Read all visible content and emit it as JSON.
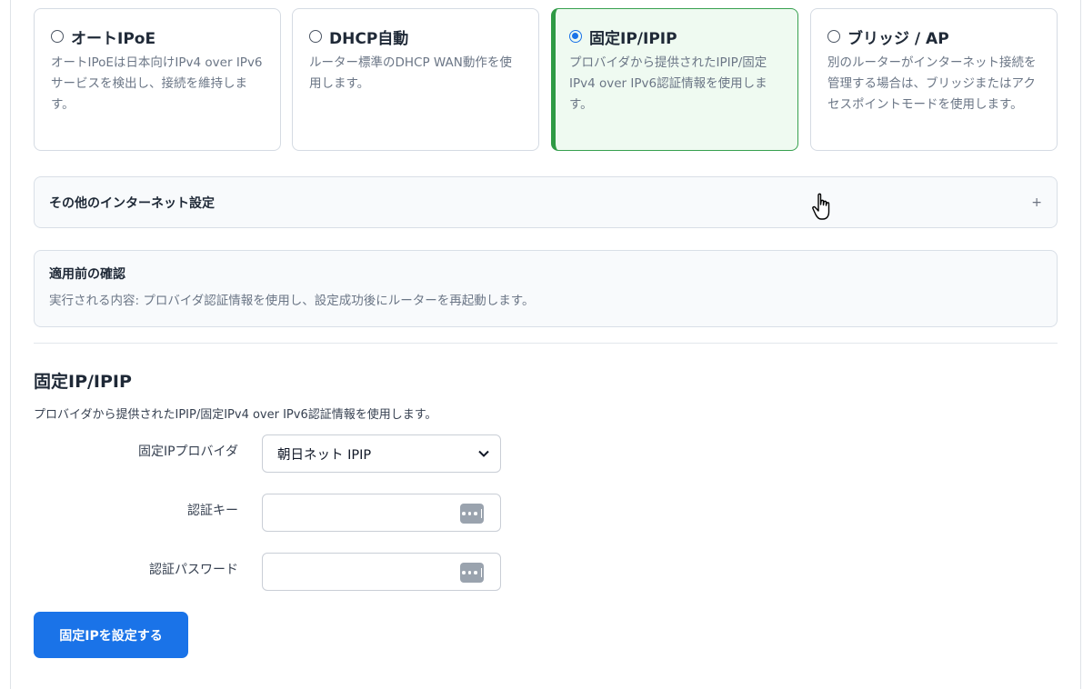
{
  "modes": [
    {
      "label": "オートIPoE",
      "desc": "オートIPoEは日本向けIPv4 over IPv6サービスを検出し、接続を維持します。",
      "selected": false
    },
    {
      "label": "DHCP自動",
      "desc": "ルーター標準のDHCP WAN動作を使用します。",
      "selected": false
    },
    {
      "label": "固定IP/IPIP",
      "desc": "プロバイダから提供されたIPIP/固定IPv4 over IPv6認証情報を使用します。",
      "selected": true
    },
    {
      "label": "ブリッジ / AP",
      "desc": "別のルーターがインターネット接続を管理する場合は、ブリッジまたはアクセスポイントモードを使用します。",
      "selected": false
    }
  ],
  "other_settings": {
    "label": "その他のインターネット設定",
    "toggle": "+"
  },
  "confirm": {
    "title": "適用前の確認",
    "text": "実行される内容: プロバイダ認証情報を使用し、設定成功後にルーターを再起動します。"
  },
  "section": {
    "title": "固定IP/IPIP",
    "desc": "プロバイダから提供されたIPIP/固定IPv4 over IPv6認証情報を使用します。"
  },
  "form": {
    "provider_label": "固定IPプロバイダ",
    "provider_value": "朝日ネット IPIP",
    "auth_key_label": "認証キー",
    "auth_key_value": "",
    "auth_password_label": "認証パスワード",
    "auth_password_value": ""
  },
  "submit_label": "固定IPを設定する",
  "colors": {
    "accent": "#1a73e8",
    "selected_border": "#2f9a45",
    "selected_bg": "#effaf1"
  }
}
